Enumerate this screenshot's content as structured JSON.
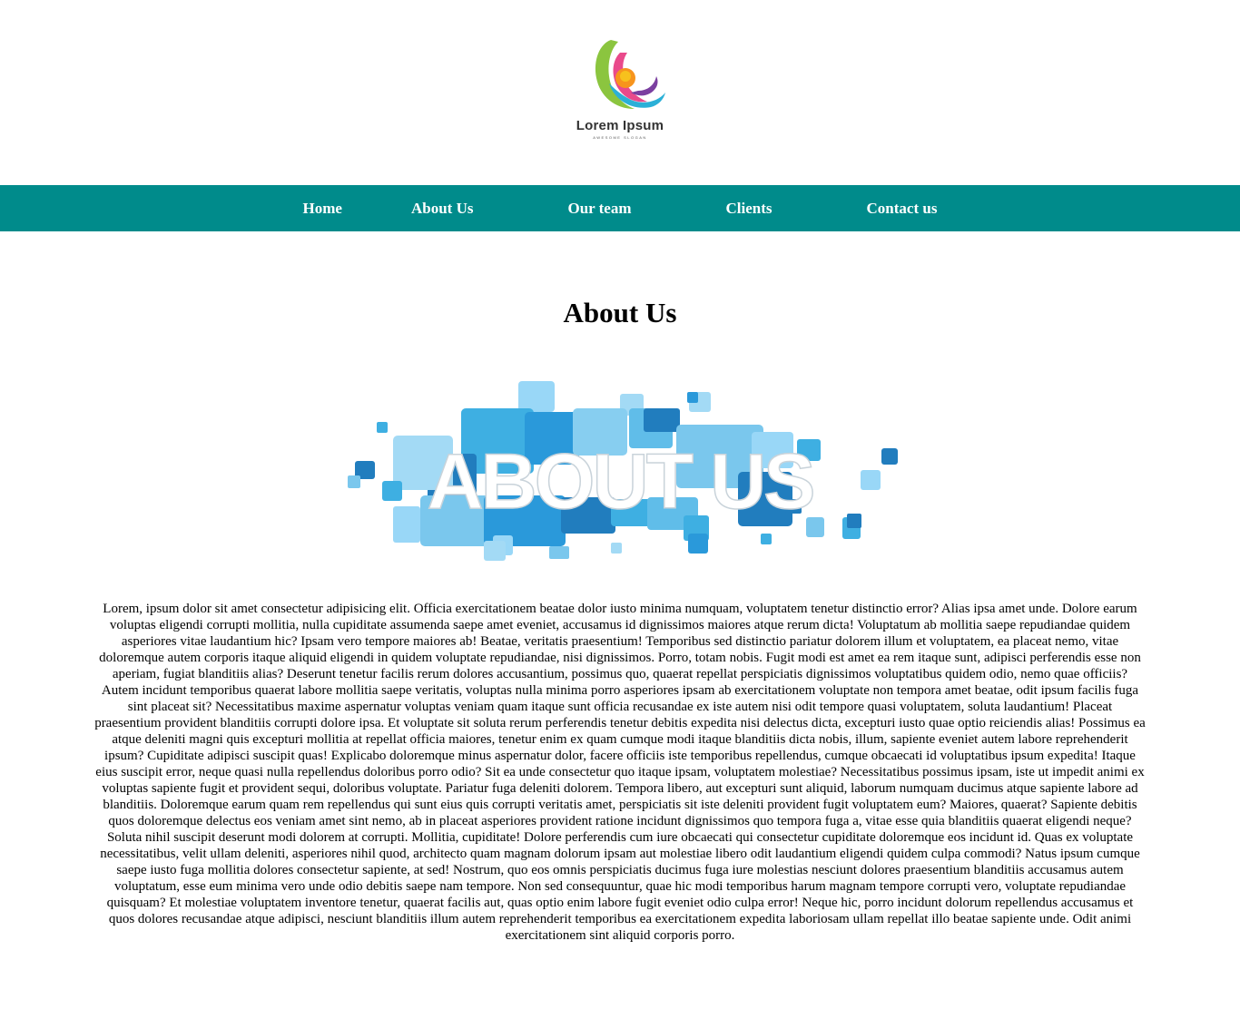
{
  "brand": {
    "name": "Lorem Ipsum",
    "tagline": "AWESOME SLOGAN",
    "colors": [
      "#8bc53f",
      "#e94a8b",
      "#2bb0d7",
      "#f7941d",
      "#7b3fa0"
    ]
  },
  "nav": {
    "background": "#008b8b",
    "items": [
      {
        "label": "Home"
      },
      {
        "label": "About Us"
      },
      {
        "label": "Our team"
      },
      {
        "label": "Clients"
      },
      {
        "label": "Contact us"
      }
    ]
  },
  "main": {
    "title": "About Us",
    "banner_text": "ABOUT US",
    "body": "Lorem, ipsum dolor sit amet consectetur adipisicing elit. Officia exercitationem beatae dolor iusto minima numquam, voluptatem tenetur distinctio error? Alias ipsa amet unde. Dolore earum voluptas eligendi corrupti mollitia, nulla cupiditate assumenda saepe amet eveniet, accusamus id dignissimos maiores atque rerum dicta! Voluptatum ab mollitia saepe repudiandae quidem asperiores vitae laudantium hic? Ipsam vero tempore maiores ab! Beatae, veritatis praesentium! Temporibus sed distinctio pariatur dolorem illum et voluptatem, ea placeat nemo, vitae doloremque autem corporis itaque aliquid eligendi in quidem voluptate repudiandae, nisi dignissimos. Porro, totam nobis. Fugit modi est amet ea rem itaque sunt, adipisci perferendis esse non aperiam, fugiat blanditiis alias? Deserunt tenetur facilis rerum dolores accusantium, possimus quo, quaerat repellat perspiciatis dignissimos voluptatibus quidem odio, nemo quae officiis? Autem incidunt temporibus quaerat labore mollitia saepe veritatis, voluptas nulla minima porro asperiores ipsam ab exercitationem voluptate non tempora amet beatae, odit ipsum facilis fuga sint placeat sit? Necessitatibus maxime aspernatur voluptas veniam quam itaque sunt officia recusandae ex iste autem nisi odit tempore quasi voluptatem, soluta laudantium! Placeat praesentium provident blanditiis corrupti dolore ipsa. Et voluptate sit soluta rerum perferendis tenetur debitis expedita nisi delectus dicta, excepturi iusto quae optio reiciendis alias! Possimus ea atque deleniti magni quis excepturi mollitia at repellat officia maiores, tenetur enim ex quam cumque modi itaque blanditiis dicta nobis, illum, sapiente eveniet autem labore reprehenderit ipsum? Cupiditate adipisci suscipit quas! Explicabo doloremque minus aspernatur dolor, facere officiis iste temporibus repellendus, cumque obcaecati id voluptatibus ipsum expedita! Itaque eius suscipit error, neque quasi nulla repellendus doloribus porro odio? Sit ea unde consectetur quo itaque ipsam, voluptatem molestiae? Necessitatibus possimus ipsam, iste ut impedit animi ex voluptas sapiente fugit et provident sequi, doloribus voluptate. Pariatur fuga deleniti dolorem. Tempora libero, aut excepturi sunt aliquid, laborum numquam ducimus atque sapiente labore ad blanditiis. Doloremque earum quam rem repellendus qui sunt eius quis corrupti veritatis amet, perspiciatis sit iste deleniti provident fugit voluptatem eum? Maiores, quaerat? Sapiente debitis quos doloremque delectus eos veniam amet sint nemo, ab in placeat asperiores provident ratione incidunt dignissimos quo tempora fuga a, vitae esse quia blanditiis quaerat eligendi neque? Soluta nihil suscipit deserunt modi dolorem at corrupti. Mollitia, cupiditate! Dolore perferendis cum iure obcaecati qui consectetur cupiditate doloremque eos incidunt id. Quas ex voluptate necessitatibus, velit ullam deleniti, asperiores nihil quod, architecto quam magnam dolorum ipsam aut molestiae libero odit laudantium eligendi quidem culpa commodi? Natus ipsum cumque saepe iusto fuga mollitia dolores consectetur sapiente, at sed! Nostrum, quo eos omnis perspiciatis ducimus fuga iure molestias nesciunt dolores praesentium blanditiis accusamus autem voluptatum, esse eum minima vero unde odio debitis saepe nam tempore. Non sed consequuntur, quae hic modi temporibus harum magnam tempore corrupti vero, voluptate repudiandae quisquam? Et molestiae voluptatem inventore tenetur, quaerat facilis aut, quas optio enim labore fugit eveniet odio culpa error! Neque hic, porro incidunt dolorum repellendus accusamus et quos dolores recusandae atque adipisci, nesciunt blanditiis illum autem reprehenderit temporibus ea exercitationem expedita laboriosam ullam repellat illo beatae sapiente unde. Odit animi exercitationem sint aliquid corporis porro."
  }
}
